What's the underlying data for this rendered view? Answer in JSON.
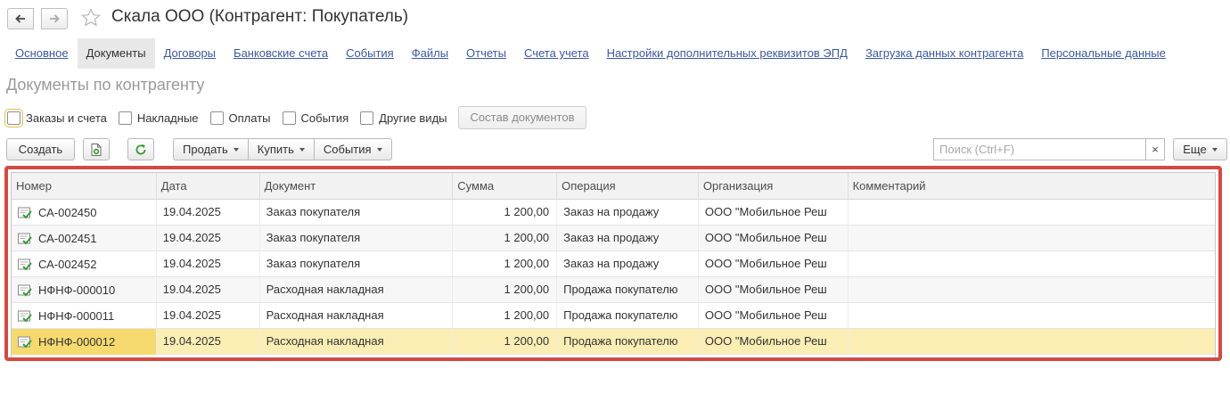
{
  "window": {
    "title": "Скала ООО (Контрагент: Покупатель)"
  },
  "tabs": [
    {
      "label": "Основное",
      "active": false
    },
    {
      "label": "Документы",
      "active": true
    },
    {
      "label": "Договоры",
      "active": false
    },
    {
      "label": "Банковские счета",
      "active": false
    },
    {
      "label": "События",
      "active": false
    },
    {
      "label": "Файлы",
      "active": false
    },
    {
      "label": "Отчеты",
      "active": false
    },
    {
      "label": "Счета учета",
      "active": false
    },
    {
      "label": "Настройки дополнительных реквизитов ЭПД",
      "active": false
    },
    {
      "label": "Загрузка данных контрагента",
      "active": false
    },
    {
      "label": "Персональные данные",
      "active": false
    }
  ],
  "section": {
    "title": "Документы по контрагенту"
  },
  "filters": [
    {
      "label": "Заказы и счета",
      "checked": false
    },
    {
      "label": "Накладные",
      "checked": false
    },
    {
      "label": "Оплаты",
      "checked": false
    },
    {
      "label": "События",
      "checked": false
    },
    {
      "label": "Другие виды",
      "checked": false
    }
  ],
  "compose_button": "Состав документов",
  "toolbar": {
    "create": "Создать",
    "sell": "Продать",
    "buy": "Купить",
    "events": "События",
    "search_placeholder": "Поиск (Ctrl+F)",
    "search_clear": "×",
    "more": "Еще"
  },
  "table": {
    "columns": [
      "Номер",
      "Дата",
      "Документ",
      "Сумма",
      "Операция",
      "Организация",
      "Комментарий"
    ],
    "rows": [
      {
        "number": "СА-002450",
        "date": "19.04.2025",
        "document": "Заказ покупателя",
        "sum": "1 200,00",
        "operation": "Заказ на продажу",
        "org": "ООО \"Мобильное Реш",
        "comment": ""
      },
      {
        "number": "СА-002451",
        "date": "19.04.2025",
        "document": "Заказ покупателя",
        "sum": "1 200,00",
        "operation": "Заказ на продажу",
        "org": "ООО \"Мобильное Реш",
        "comment": ""
      },
      {
        "number": "СА-002452",
        "date": "19.04.2025",
        "document": "Заказ покупателя",
        "sum": "1 200,00",
        "operation": "Заказ на продажу",
        "org": "ООО \"Мобильное Реш",
        "comment": ""
      },
      {
        "number": "НФНФ-000010",
        "date": "19.04.2025",
        "document": "Расходная накладная",
        "sum": "1 200,00",
        "operation": "Продажа покупателю",
        "org": "ООО \"Мобильное Реш",
        "comment": ""
      },
      {
        "number": "НФНФ-000011",
        "date": "19.04.2025",
        "document": "Расходная накладная",
        "sum": "1 200,00",
        "operation": "Продажа покупателю",
        "org": "ООО \"Мобильное Реш",
        "comment": ""
      },
      {
        "number": "НФНФ-000012",
        "date": "19.04.2025",
        "document": "Расходная накладная",
        "sum": "1 200,00",
        "operation": "Продажа покупателю",
        "org": "ООО \"Мобильное Реш",
        "comment": "",
        "selected": true
      }
    ]
  },
  "colors": {
    "link": "#3b5a9c",
    "highlight_frame": "#d24a44",
    "selected_row": "#fbeeb4",
    "selected_cell": "#f6d96f",
    "refresh_green": "#3a9a3a"
  }
}
